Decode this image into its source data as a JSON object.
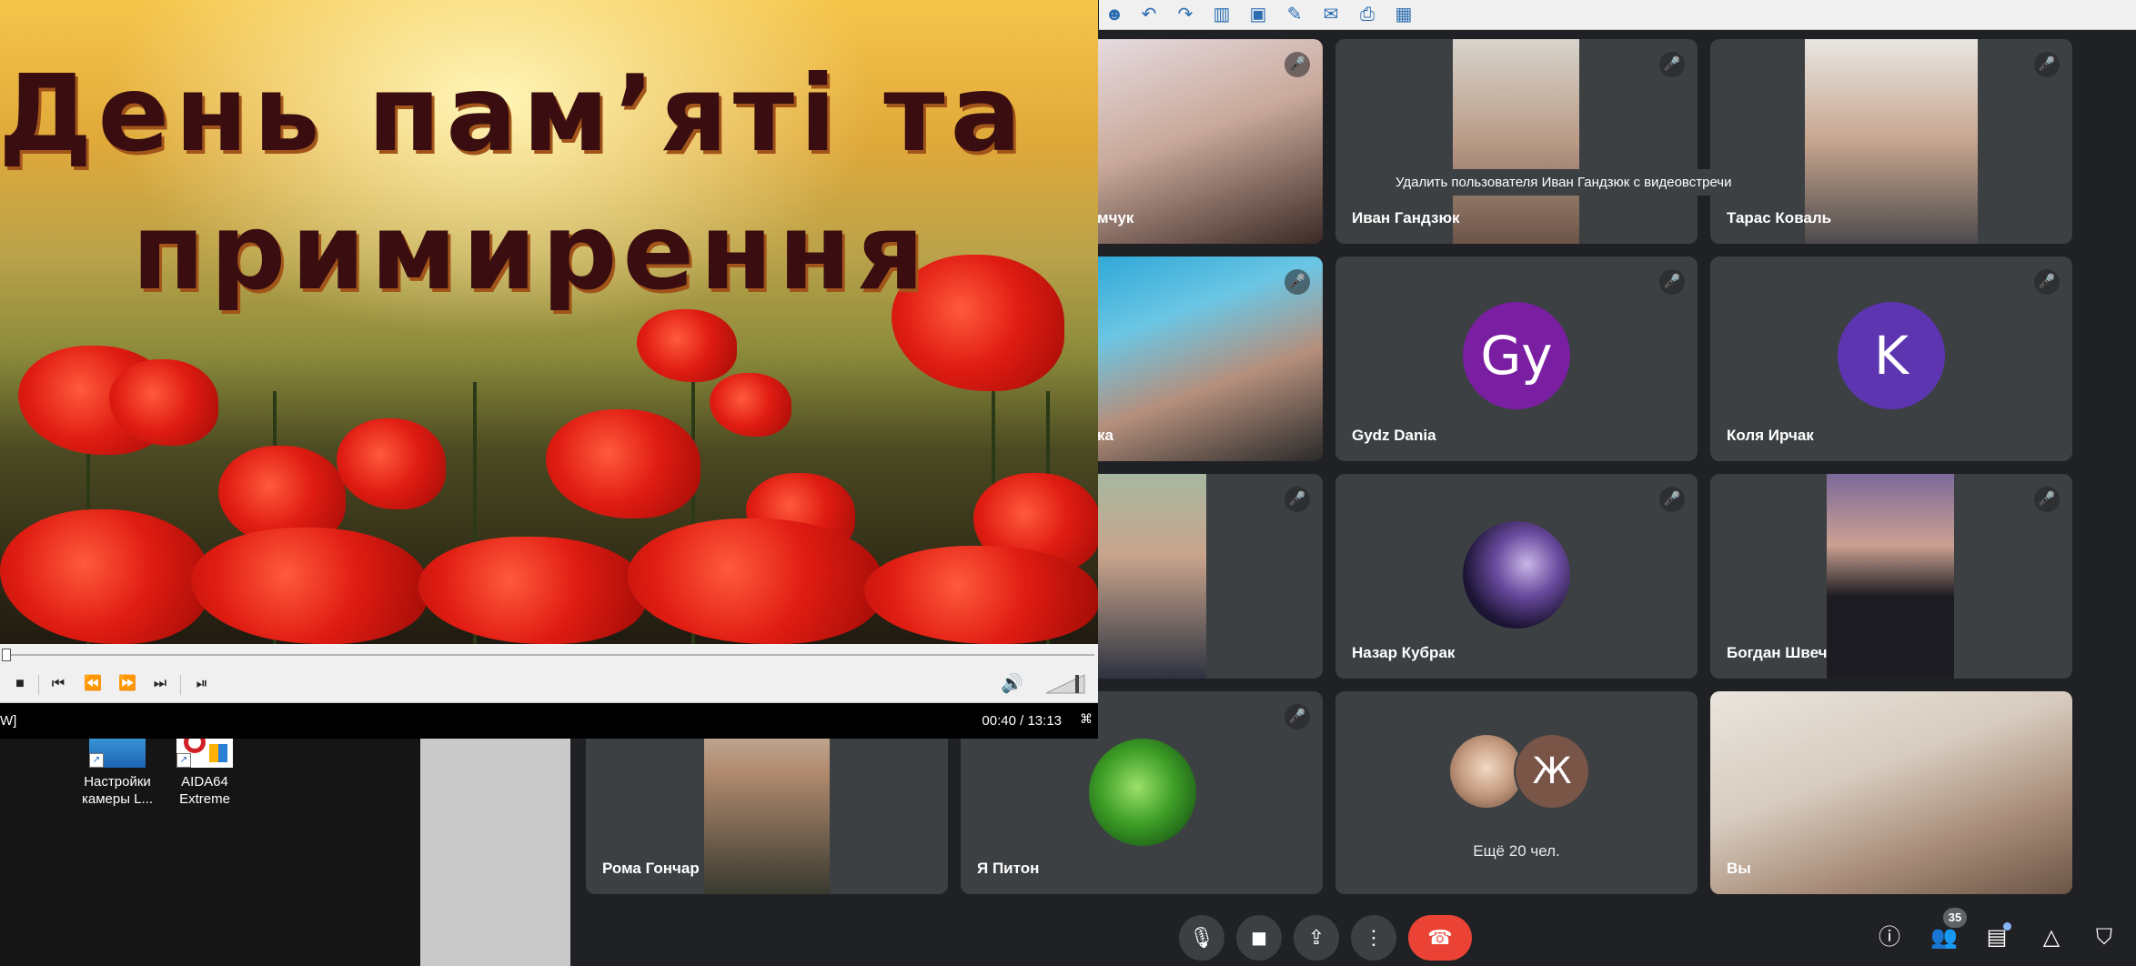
{
  "desktop": {
    "icons": [
      {
        "label": "Настройки камеры L...",
        "glyph": "camera-settings-icon"
      },
      {
        "label": "AIDA64 Extreme",
        "glyph": "aida64-icon"
      }
    ]
  },
  "player": {
    "slide": {
      "line1": "День пам’яті та",
      "line2": "примирення"
    },
    "status_left": "W]",
    "time": "00:40 / 13:13",
    "mode": "⌘"
  },
  "meet": {
    "tooltip": "Удалить пользователя Иван Гандзюк с видеовстречи",
    "tiles": [
      {
        "name": "мчук",
        "type": "video"
      },
      {
        "name": "Иван Гандзюк",
        "type": "video"
      },
      {
        "name": "Тарас Коваль",
        "type": "video"
      },
      {
        "name": "ка",
        "type": "video"
      },
      {
        "name": "Gydz Dania",
        "type": "avatar",
        "initials": "Gy",
        "color": "#7b1fa2"
      },
      {
        "name": "Коля Ирчак",
        "type": "avatar",
        "initials": "K",
        "color": "#5e35b1"
      },
      {
        "name": "",
        "type": "video"
      },
      {
        "name": "Назар Кубрак",
        "type": "avatar-image"
      },
      {
        "name": "Богдан Швеч",
        "type": "video"
      },
      {
        "name": "Рома Гончар",
        "type": "video"
      },
      {
        "name": "Я Питон",
        "type": "avatar-image"
      },
      {
        "name": "Ещё 20 чел.",
        "type": "more",
        "second_initial": "Ж"
      },
      {
        "name": "Вы",
        "type": "video"
      }
    ],
    "participants_count": "35",
    "colors": {
      "end_call": "#ea4335",
      "tile": "#3c4043",
      "background": "#202124"
    }
  }
}
